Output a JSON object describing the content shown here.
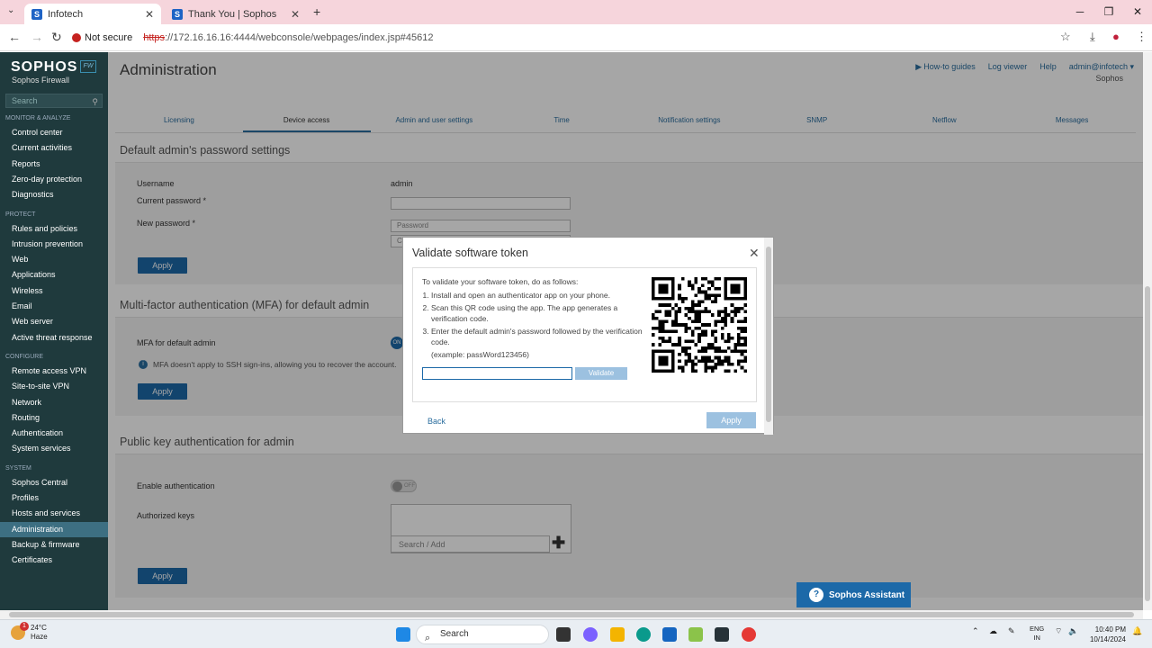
{
  "browser": {
    "tabs": [
      {
        "title": "Infotech",
        "favicon": "S",
        "active": true
      },
      {
        "title": "Thank You | Sophos",
        "favicon": "S",
        "active": false
      }
    ],
    "not_secure_label": "Not secure",
    "url_scheme": "https",
    "url_rest": "://172.16.16.16:4444/webconsole/webpages/index.jsp#45612"
  },
  "sidebar": {
    "logo": "SOPHOS",
    "logo_badge": "FW",
    "product": "Sophos Firewall",
    "search_placeholder": "Search",
    "sections": [
      {
        "title": "MONITOR & ANALYZE",
        "items": [
          "Control center",
          "Current activities",
          "Reports",
          "Zero-day protection",
          "Diagnostics"
        ]
      },
      {
        "title": "PROTECT",
        "items": [
          "Rules and policies",
          "Intrusion prevention",
          "Web",
          "Applications",
          "Wireless",
          "Email",
          "Web server",
          "Active threat response"
        ]
      },
      {
        "title": "CONFIGURE",
        "items": [
          "Remote access VPN",
          "Site-to-site VPN",
          "Network",
          "Routing",
          "Authentication",
          "System services"
        ]
      },
      {
        "title": "SYSTEM",
        "items": [
          "Sophos Central",
          "Profiles",
          "Hosts and services",
          "Administration",
          "Backup & firmware",
          "Certificates"
        ]
      }
    ],
    "active_item": "Administration"
  },
  "header": {
    "title": "Administration",
    "links": [
      "How-to guides",
      "Log viewer",
      "Help",
      "admin@infotech ▾"
    ],
    "sub": "Sophos"
  },
  "tabs": [
    "Licensing",
    "Device access",
    "Admin and user settings",
    "Time",
    "Notification settings",
    "SNMP",
    "Netflow",
    "Messages"
  ],
  "active_tab": "Device access",
  "password_section": {
    "title": "Default admin's password settings",
    "username_label": "Username",
    "username_value": "admin",
    "current_label": "Current password *",
    "new_label": "New password *",
    "new_placeholder": "Password",
    "confirm_placeholder": "C",
    "apply": "Apply"
  },
  "mfa_section": {
    "title": "Multi-factor authentication (MFA) for default admin",
    "label": "MFA for default admin",
    "toggle": "ON",
    "note": "MFA doesn't apply to SSH sign-ins, allowing you to recover the account.",
    "apply": "Apply"
  },
  "pubkey_section": {
    "title": "Public key authentication for admin",
    "enable_label": "Enable authentication",
    "toggle": "OFF",
    "keys_label": "Authorized keys",
    "search_placeholder": "Search / Add",
    "apply": "Apply"
  },
  "modal": {
    "title": "Validate software token",
    "intro": "To validate your software token, do as follows:",
    "steps": [
      "Install and open an authenticator app on your phone.",
      "Scan this QR code using the app. The app generates a verification code.",
      "Enter the default admin's password followed by the verification code."
    ],
    "example": "(example: passWord123456)",
    "token_value": "",
    "validate": "Validate",
    "back": "Back",
    "apply": "Apply"
  },
  "assistant": "Sophos Assistant",
  "taskbar": {
    "temp": "24°C",
    "weather": "Haze",
    "notif_count": "1",
    "search": "Search",
    "lang1": "ENG",
    "lang2": "IN",
    "time": "10:40 PM",
    "date": "10/14/2024"
  }
}
